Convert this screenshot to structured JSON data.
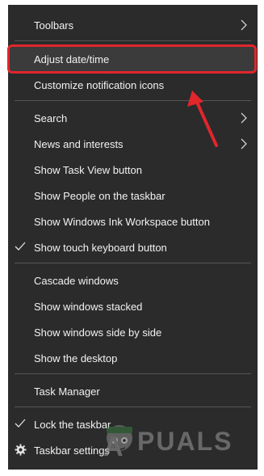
{
  "menu": {
    "items": [
      {
        "label": "Toolbars"
      },
      {
        "label": "Adjust date/time"
      },
      {
        "label": "Customize notification icons"
      },
      {
        "label": "Search"
      },
      {
        "label": "News and interests"
      },
      {
        "label": "Show Task View button"
      },
      {
        "label": "Show People on the taskbar"
      },
      {
        "label": "Show Windows Ink Workspace button"
      },
      {
        "label": "Show touch keyboard button"
      },
      {
        "label": "Cascade windows"
      },
      {
        "label": "Show windows stacked"
      },
      {
        "label": "Show windows side by side"
      },
      {
        "label": "Show the desktop"
      },
      {
        "label": "Task Manager"
      },
      {
        "label": "Lock the taskbar"
      },
      {
        "label": "Taskbar settings"
      }
    ]
  },
  "colors": {
    "menu_bg": "#2b2b2b",
    "highlight_border": "#e1262c",
    "arrow": "#e1262c"
  },
  "watermark": {
    "text": "APPUALS"
  }
}
